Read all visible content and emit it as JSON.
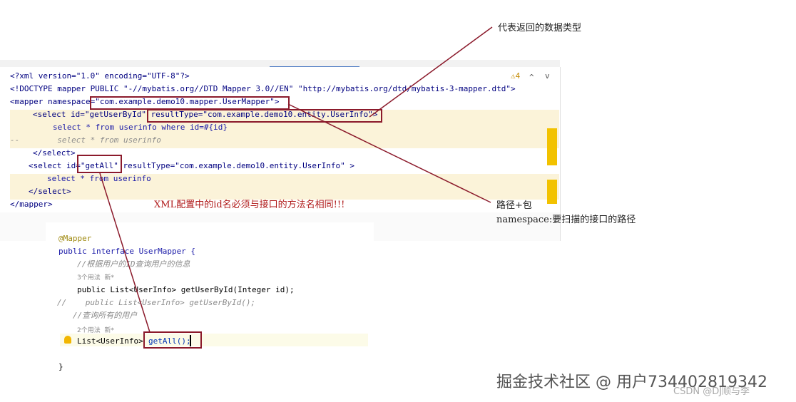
{
  "xml_editor": {
    "inspection_count": "⚠4",
    "nav_up": "^",
    "nav_down": "v",
    "lines": [
      "<?xml version=\"1.0\" encoding=\"UTF-8\"?>",
      "<!DOCTYPE mapper PUBLIC \"-//mybatis.org//DTD Mapper 3.0//EN\" \"http://mybatis.org/dtd/mybatis-3-mapper.dtd\">",
      "<mapper namespace=\"com.example.demo10.mapper.UserMapper\">",
      "<select id=\"getUserById\" resultType=\"com.example.demo10.entity.UserInfo\">",
      "select * from userinfo where id=#{id}",
      "--        select * from userinfo",
      "</select>",
      "<select id=\"getAll\" resultType=\"com.example.demo10.entity.UserInfo\" >",
      "select * from userinfo",
      "</select>",
      "</mapper>"
    ]
  },
  "java_editor": {
    "annotation": "@Mapper",
    "interface_decl": "public interface UserMapper {",
    "comment1": "//根据用户的ID查询用户的信息",
    "usage1": "3个用法  新*",
    "method1": "public List<UserInfo> getUserById(Integer id);",
    "commented_method": "//    public List<UserInfo> getUserById();",
    "comment2": "//查询所有的用户",
    "usage2": "2个用法  新*",
    "method2_type": "List<UserInfo> ",
    "method2_name": "getAll();",
    "closing": "}"
  },
  "annotations": {
    "return_type_note": "代表返回的数据类型",
    "id_note": "XML配置中的id名必须与接口的方法名相同!!!",
    "namespace_note1": "路径+包",
    "namespace_note2": "namespace:要扫描的接口的路径"
  },
  "watermark": "掘金技术社区 @ 用户7344028193​42",
  "watermark2": "CSDN @DJ顺与李"
}
